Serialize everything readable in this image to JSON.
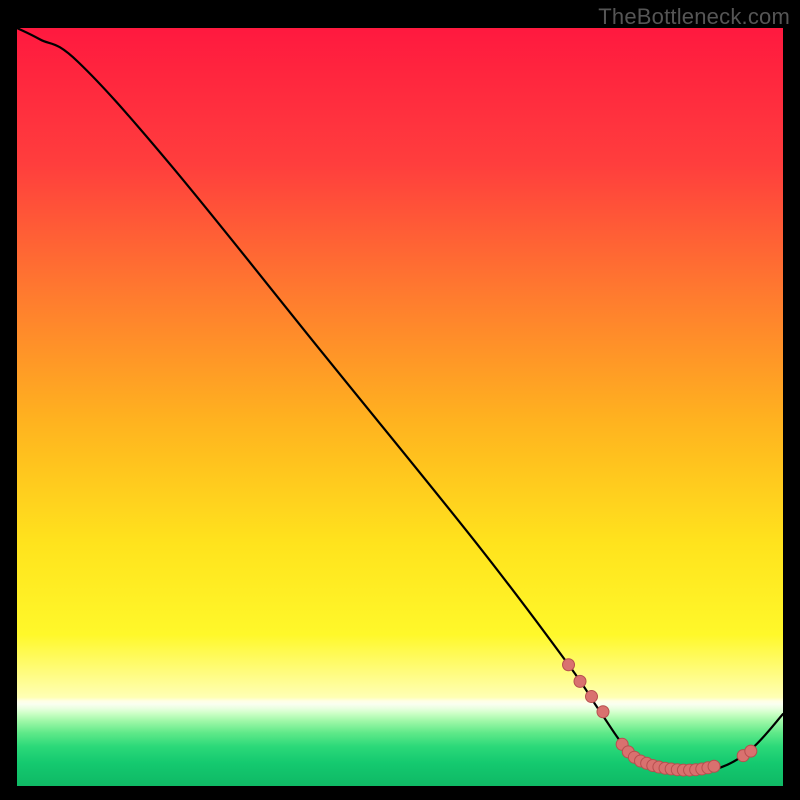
{
  "watermark": "TheBottleneck.com",
  "colors": {
    "background": "#000000",
    "line": "#000000",
    "marker_fill": "#d9716f",
    "marker_stroke": "#b74f4f",
    "gradient_stops": [
      {
        "offset": 0.0,
        "color": "#ff193f"
      },
      {
        "offset": 0.18,
        "color": "#ff3e3d"
      },
      {
        "offset": 0.35,
        "color": "#ff7a2f"
      },
      {
        "offset": 0.52,
        "color": "#ffb31f"
      },
      {
        "offset": 0.68,
        "color": "#ffe31d"
      },
      {
        "offset": 0.8,
        "color": "#fff82a"
      },
      {
        "offset": 0.883,
        "color": "#ffffb5"
      },
      {
        "offset": 0.888,
        "color": "#ffffe6"
      },
      {
        "offset": 0.892,
        "color": "#fafff0"
      },
      {
        "offset": 0.898,
        "color": "#e8ffdf"
      },
      {
        "offset": 0.905,
        "color": "#c9ffc4"
      },
      {
        "offset": 0.915,
        "color": "#9cf7a6"
      },
      {
        "offset": 0.93,
        "color": "#5fe989"
      },
      {
        "offset": 0.948,
        "color": "#2bd979"
      },
      {
        "offset": 0.97,
        "color": "#14c96f"
      },
      {
        "offset": 1.0,
        "color": "#0fb965"
      }
    ]
  },
  "chart_data": {
    "type": "line",
    "title": "",
    "xlabel": "",
    "ylabel": "",
    "xlim": [
      0,
      100
    ],
    "ylim": [
      0,
      100
    ],
    "grid": false,
    "legend": false,
    "series": [
      {
        "name": "bottleneck-curve",
        "x": [
          0,
          3,
          8,
          20,
          40,
          60,
          72,
          76,
          80,
          84,
          88,
          92,
          96,
          100
        ],
        "y": [
          100,
          98.5,
          95.5,
          82,
          57,
          32,
          16,
          10,
          4.5,
          2.5,
          2,
          2.5,
          5,
          9.5
        ]
      }
    ],
    "markers": {
      "name": "highlight-points",
      "x": [
        72.0,
        73.5,
        75.0,
        76.5,
        79.0,
        79.8,
        80.6,
        81.4,
        82.2,
        83.0,
        83.8,
        84.6,
        85.4,
        86.2,
        87.0,
        87.8,
        88.6,
        89.4,
        90.2,
        91.0,
        94.8,
        95.8
      ],
      "y": [
        16.0,
        13.8,
        11.8,
        9.8,
        5.5,
        4.5,
        3.8,
        3.3,
        3.0,
        2.7,
        2.5,
        2.35,
        2.25,
        2.15,
        2.1,
        2.1,
        2.15,
        2.25,
        2.4,
        2.6,
        4.0,
        4.6
      ]
    }
  }
}
